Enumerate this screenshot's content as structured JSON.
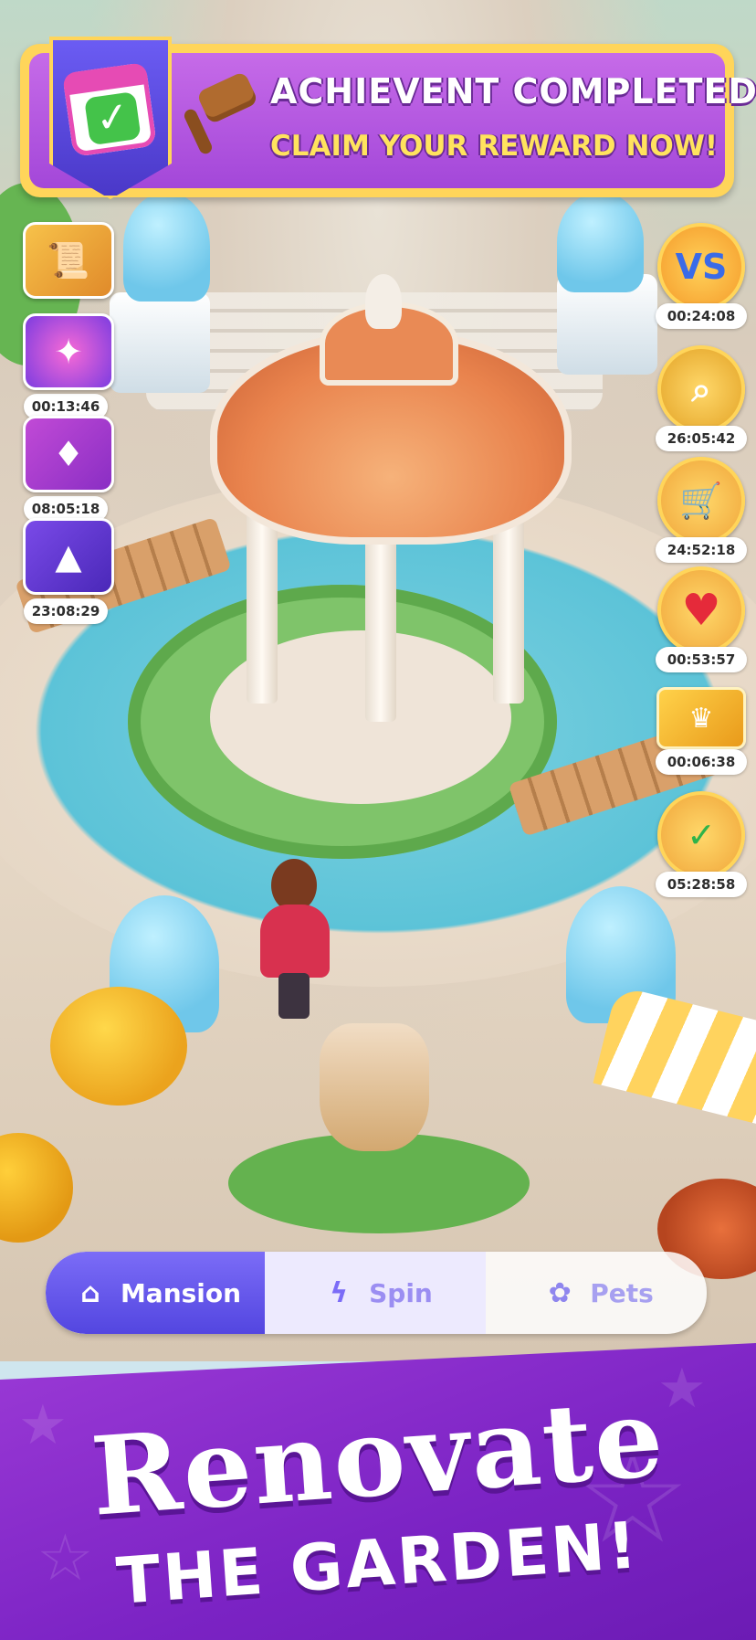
{
  "banner": {
    "title": "ACHIEVENT COMPLETED!",
    "subtitle": "CLAIM YOUR REWARD NOW!",
    "icon": "calendar-check-icon",
    "reward_icon": "hammer-icon"
  },
  "left_events": [
    {
      "icon": "scroll-coins-icon",
      "timer": ""
    },
    {
      "icon": "disco-ball-icon",
      "timer": "00:13:46"
    },
    {
      "icon": "card-pack-icon",
      "timer": "08:05:18"
    },
    {
      "icon": "witch-hat-icon",
      "timer": "23:08:29"
    }
  ],
  "right_events": [
    {
      "icon": "versus-dice-icon",
      "timer": "00:24:08"
    },
    {
      "icon": "magnifier-garden-icon",
      "timer": "26:05:42"
    },
    {
      "icon": "shopping-cart-icon",
      "timer": "24:52:18"
    },
    {
      "icon": "heart-plus-icon",
      "timer": "00:53:57"
    },
    {
      "icon": "crown-ticket-icon",
      "timer": "00:06:38"
    },
    {
      "icon": "calendar-check-icon",
      "timer": "05:28:58"
    }
  ],
  "tabs": [
    {
      "label": "Mansion",
      "icon": "house-icon",
      "active": true
    },
    {
      "label": "Spin",
      "icon": "lightning-icon",
      "active": false
    },
    {
      "label": "Pets",
      "icon": "paw-icon",
      "active": false
    }
  ],
  "promo": {
    "line1": "Renovate",
    "line2": "THE GARDEN!"
  },
  "colors": {
    "accent_purple": "#a347d9",
    "banner_gold": "#ffd55a",
    "tab_active": "#5346e0",
    "promo_bg": "#7b23c4"
  }
}
